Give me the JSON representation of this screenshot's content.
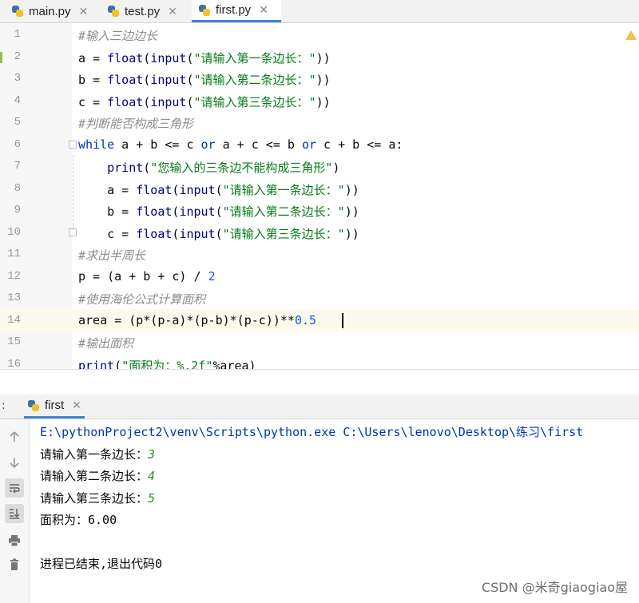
{
  "tabs": [
    {
      "label": "main.py",
      "close": "✕"
    },
    {
      "label": "test.py",
      "close": "✕"
    },
    {
      "label": "first.py",
      "close": "✕"
    }
  ],
  "editor": {
    "line_numbers": [
      "1",
      "2",
      "3",
      "4",
      "5",
      "6",
      "7",
      "8",
      "9",
      "10",
      "11",
      "12",
      "13",
      "14",
      "15",
      "16"
    ],
    "lines": [
      [
        {
          "t": "#输入三边边长",
          "c": "com"
        }
      ],
      [
        {
          "t": "a = ",
          "c": ""
        },
        {
          "t": "float",
          "c": "fn"
        },
        {
          "t": "(",
          "c": ""
        },
        {
          "t": "input",
          "c": "fn"
        },
        {
          "t": "(",
          "c": ""
        },
        {
          "t": "\"请输入第一条边长：\"",
          "c": "str"
        },
        {
          "t": "))",
          "c": ""
        }
      ],
      [
        {
          "t": "b = ",
          "c": ""
        },
        {
          "t": "float",
          "c": "fn"
        },
        {
          "t": "(",
          "c": ""
        },
        {
          "t": "input",
          "c": "fn"
        },
        {
          "t": "(",
          "c": ""
        },
        {
          "t": "\"请输入第二条边长：\"",
          "c": "str"
        },
        {
          "t": "))",
          "c": ""
        }
      ],
      [
        {
          "t": "c = ",
          "c": ""
        },
        {
          "t": "float",
          "c": "fn"
        },
        {
          "t": "(",
          "c": ""
        },
        {
          "t": "input",
          "c": "fn"
        },
        {
          "t": "(",
          "c": ""
        },
        {
          "t": "\"请输入第三条边长：\"",
          "c": "str"
        },
        {
          "t": "))",
          "c": ""
        }
      ],
      [
        {
          "t": "#判断能否构成三角形",
          "c": "com"
        }
      ],
      [
        {
          "t": "while",
          "c": "kw"
        },
        {
          "t": " a + b <= c ",
          "c": ""
        },
        {
          "t": "or",
          "c": "kw"
        },
        {
          "t": " a + c <= b ",
          "c": ""
        },
        {
          "t": "or",
          "c": "kw"
        },
        {
          "t": " c + b <= a:",
          "c": ""
        }
      ],
      [
        {
          "t": "    ",
          "c": ""
        },
        {
          "t": "print",
          "c": "fn"
        },
        {
          "t": "(",
          "c": ""
        },
        {
          "t": "\"您输入的三条边不能构成三角形\"",
          "c": "str"
        },
        {
          "t": ")",
          "c": ""
        }
      ],
      [
        {
          "t": "    a = ",
          "c": ""
        },
        {
          "t": "float",
          "c": "fn"
        },
        {
          "t": "(",
          "c": ""
        },
        {
          "t": "input",
          "c": "fn"
        },
        {
          "t": "(",
          "c": ""
        },
        {
          "t": "\"请输入第一条边长：\"",
          "c": "str"
        },
        {
          "t": "))",
          "c": ""
        }
      ],
      [
        {
          "t": "    b = ",
          "c": ""
        },
        {
          "t": "float",
          "c": "fn"
        },
        {
          "t": "(",
          "c": ""
        },
        {
          "t": "input",
          "c": "fn"
        },
        {
          "t": "(",
          "c": ""
        },
        {
          "t": "\"请输入第二条边长：\"",
          "c": "str"
        },
        {
          "t": "))",
          "c": ""
        }
      ],
      [
        {
          "t": "    c = ",
          "c": ""
        },
        {
          "t": "float",
          "c": "fn"
        },
        {
          "t": "(",
          "c": ""
        },
        {
          "t": "input",
          "c": "fn"
        },
        {
          "t": "(",
          "c": ""
        },
        {
          "t": "\"请输入第三条边长：\"",
          "c": "str"
        },
        {
          "t": "))",
          "c": ""
        }
      ],
      [
        {
          "t": "#求出半周长",
          "c": "com"
        }
      ],
      [
        {
          "t": "p = (a + b + c) / ",
          "c": ""
        },
        {
          "t": "2",
          "c": "num"
        }
      ],
      [
        {
          "t": "#使用海伦公式计算面积",
          "c": "com"
        }
      ],
      [
        {
          "t": "area = (p*(p-a)*(p-b)*(p-c))**",
          "c": ""
        },
        {
          "t": "0.5",
          "c": "num"
        }
      ],
      [
        {
          "t": "#输出面积",
          "c": "com"
        }
      ],
      [
        {
          "t": "print",
          "c": "fn"
        },
        {
          "t": "(",
          "c": ""
        },
        {
          "t": "\"面积为：%.2f\"",
          "c": "str"
        },
        {
          "t": "%area)",
          "c": ""
        }
      ]
    ]
  },
  "run_panel": {
    "prefix": ":",
    "tab_label": "first",
    "close": "✕",
    "output": [
      {
        "parts": [
          {
            "t": "E:\\pythonProject2\\venv\\Scripts\\python.exe C:\\Users\\lenovo\\Desktop\\练习\\first",
            "c": "cmd"
          }
        ]
      },
      {
        "parts": [
          {
            "t": "请输入第一条边长：",
            "c": ""
          },
          {
            "t": "3",
            "c": "inp"
          }
        ]
      },
      {
        "parts": [
          {
            "t": "请输入第二条边长：",
            "c": ""
          },
          {
            "t": "4",
            "c": "inp"
          }
        ]
      },
      {
        "parts": [
          {
            "t": "请输入第三条边长：",
            "c": ""
          },
          {
            "t": "5",
            "c": "inp"
          }
        ]
      },
      {
        "parts": [
          {
            "t": "面积为：6.00",
            "c": ""
          }
        ]
      },
      {
        "parts": [
          {
            "t": "",
            "c": ""
          }
        ]
      },
      {
        "parts": [
          {
            "t": "进程已结束,退出代码0",
            "c": ""
          }
        ]
      }
    ],
    "sidebar_icons": [
      "arrow-up-icon",
      "arrow-down-icon",
      "soft-wrap-icon",
      "scroll-to-end-icon",
      "print-icon",
      "trash-icon"
    ]
  },
  "watermark": "CSDN @米奇giaogiao屋"
}
